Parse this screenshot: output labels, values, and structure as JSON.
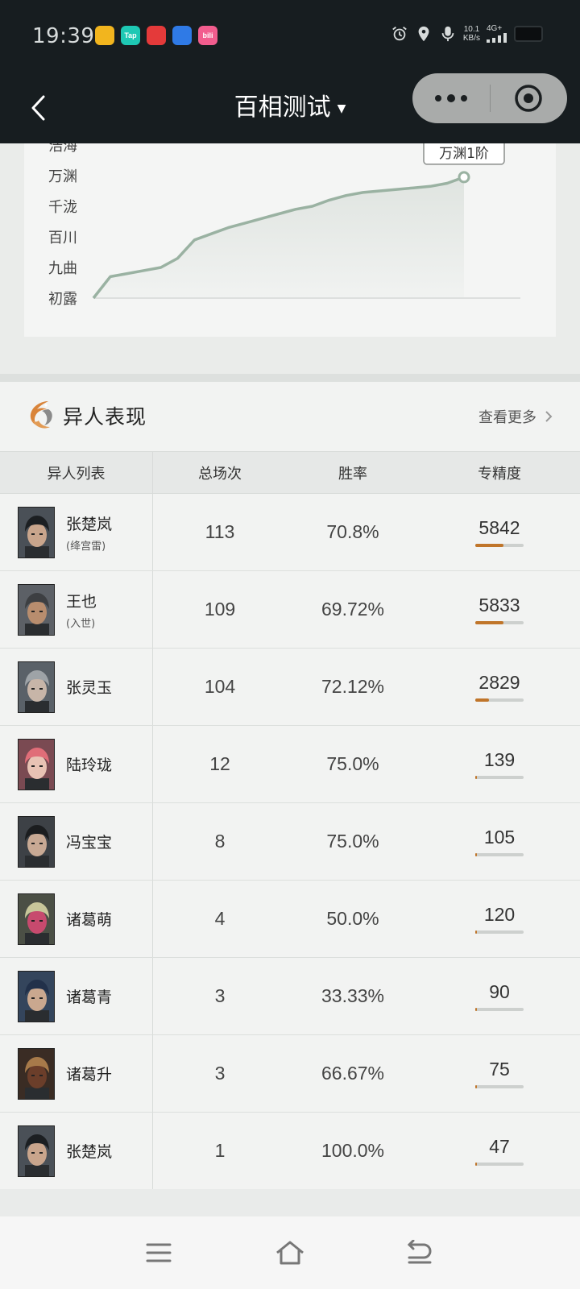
{
  "status_bar": {
    "time": "19:39",
    "apps": [
      {
        "icon": "qq-browser-icon",
        "label": "",
        "color": "#f2b51e"
      },
      {
        "icon": "taptap-icon",
        "label": "Tap",
        "color": "#1ec8b4"
      },
      {
        "icon": "heart-app-icon",
        "label": "",
        "color": "#e43a3a"
      },
      {
        "icon": "baidu-icon",
        "label": "",
        "color": "#2f7ae6"
      },
      {
        "icon": "bilibili-icon",
        "label": "bili",
        "color": "#f25d8e"
      }
    ],
    "net_speed_value": "10.1",
    "net_speed_unit": "KB/s",
    "net_type": "4G+"
  },
  "nav": {
    "title": "百相测试",
    "caret": "▼"
  },
  "rank_chart": {
    "levels": [
      "初露",
      "九曲",
      "百川",
      "千泷",
      "万渊",
      "浩海"
    ],
    "tooltip": "万渊1阶",
    "line_color": "#9ab2a2",
    "fill_color": "#dfe4e0"
  },
  "chart_data": {
    "type": "area",
    "title": "",
    "xlabel": "",
    "ylabel": "",
    "y_categories": [
      "初露",
      "九曲",
      "百川",
      "千泷",
      "万渊",
      "浩海"
    ],
    "series": [
      {
        "values": [
          0.0,
          0.7,
          0.8,
          0.9,
          1.0,
          1.3,
          1.9,
          2.1,
          2.3,
          2.45,
          2.6,
          2.75,
          2.9,
          3.0,
          3.2,
          3.35,
          3.45,
          3.5,
          3.55,
          3.6,
          3.65,
          3.75,
          3.95
        ]
      }
    ],
    "annotation": "万渊1阶",
    "ylim": [
      0,
      5
    ],
    "grid": false
  },
  "performance": {
    "title": "异人表现",
    "see_more": "查看更多",
    "columns": [
      "异人列表",
      "总场次",
      "胜率",
      "专精度"
    ],
    "rows": [
      {
        "name": "张楚岚",
        "sub": "(绛宫雷)",
        "games": "113",
        "winrate": "70.8%",
        "mastery": "5842",
        "mastery_fill": 0.58,
        "skin": "#c9a58c",
        "hair": "#1c1f22",
        "bg": "#4a5057"
      },
      {
        "name": "王也",
        "sub": "(入世)",
        "games": "109",
        "winrate": "69.72%",
        "mastery": "5833",
        "mastery_fill": 0.58,
        "skin": "#b88d6e",
        "hair": "#3d3f42",
        "bg": "#5c6066"
      },
      {
        "name": "张灵玉",
        "sub": "",
        "games": "104",
        "winrate": "72.12%",
        "mastery": "2829",
        "mastery_fill": 0.28,
        "skin": "#c7b5a8",
        "hair": "#9ea3a7",
        "bg": "#5a6168"
      },
      {
        "name": "陆玲珑",
        "sub": "",
        "games": "12",
        "winrate": "75.0%",
        "mastery": "139",
        "mastery_fill": 0.015,
        "skin": "#e8c2b4",
        "hair": "#e06d78",
        "bg": "#7a4a52"
      },
      {
        "name": "冯宝宝",
        "sub": "",
        "games": "8",
        "winrate": "75.0%",
        "mastery": "105",
        "mastery_fill": 0.012,
        "skin": "#c8a994",
        "hair": "#1b1d1f",
        "bg": "#3d4146"
      },
      {
        "name": "诸葛萌",
        "sub": "",
        "games": "4",
        "winrate": "50.0%",
        "mastery": "120",
        "mastery_fill": 0.013,
        "skin": "#c74a6e",
        "hair": "#c8c69a",
        "bg": "#4b4f45"
      },
      {
        "name": "诸葛青",
        "sub": "",
        "games": "3",
        "winrate": "33.33%",
        "mastery": "90",
        "mastery_fill": 0.01,
        "skin": "#caa88f",
        "hair": "#22314a",
        "bg": "#34455c"
      },
      {
        "name": "诸葛升",
        "sub": "",
        "games": "3",
        "winrate": "66.67%",
        "mastery": "75",
        "mastery_fill": 0.01,
        "skin": "#6b3e2a",
        "hair": "#a77a4a",
        "bg": "#3a2c24"
      },
      {
        "name": "张楚岚",
        "sub": "",
        "games": "1",
        "winrate": "100.0%",
        "mastery": "47",
        "mastery_fill": 0.008,
        "skin": "#c9a58c",
        "hair": "#1c1f22",
        "bg": "#4a5057"
      }
    ],
    "accent": "#c0752a"
  },
  "system_nav": {
    "menu_icon": "menu-icon",
    "home_icon": "home-icon",
    "back_icon": "back-icon"
  }
}
